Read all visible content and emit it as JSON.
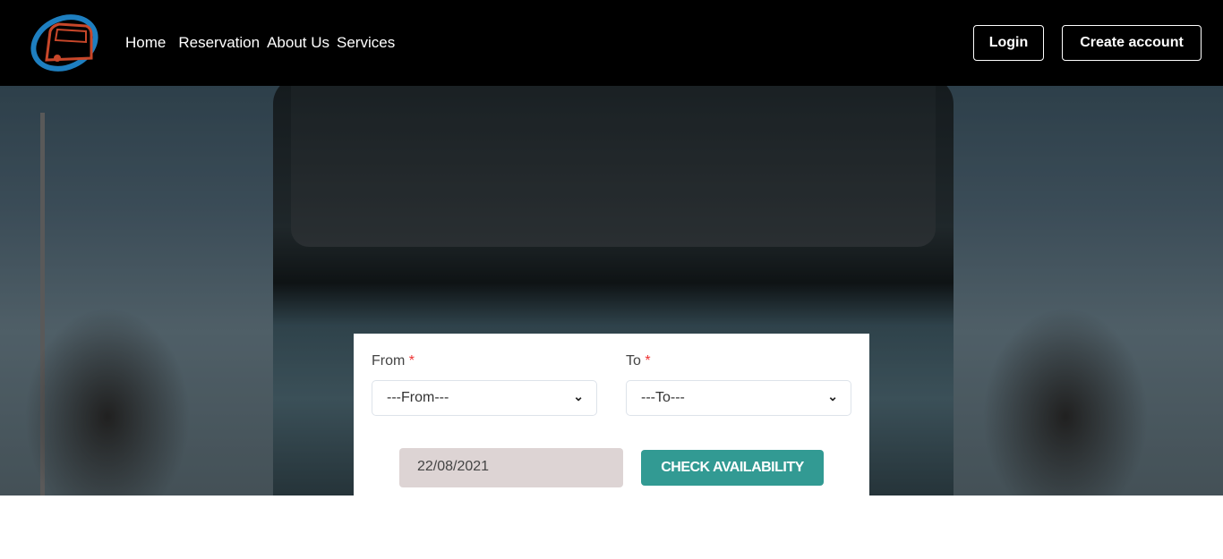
{
  "nav": {
    "links": [
      "Home",
      "Reservation",
      "About Us",
      "Services"
    ],
    "login": "Login",
    "create_account": "Create account"
  },
  "search": {
    "from_label": "From",
    "to_label": "To",
    "required_mark": "*",
    "from_value": "---From---",
    "to_value": "---To---",
    "date": "22/08/2021",
    "check": "CHECK AVAILABILITY"
  },
  "colors": {
    "accent": "#329a93",
    "logo_blue": "#1e7fc0",
    "logo_red": "#c8472a"
  }
}
